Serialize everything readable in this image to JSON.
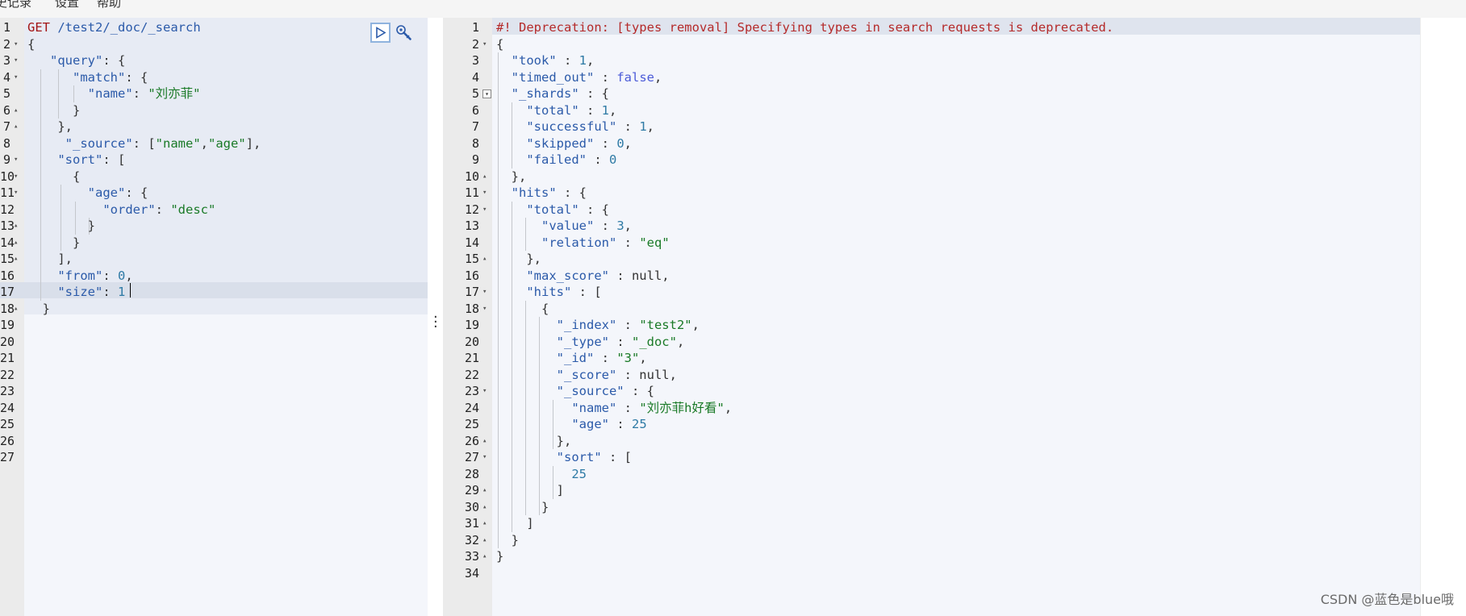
{
  "menu": {
    "items": [
      "史记录",
      "设置",
      "帮助"
    ]
  },
  "request_editor": {
    "lines": [
      {
        "num": "1",
        "fold": "",
        "html": "<span class='m'>GET</span> <span class='k'>/test2/_doc/_search</span>"
      },
      {
        "num": "2",
        "fold": "▾",
        "html": "<span class='p'>{</span>"
      },
      {
        "num": "3",
        "fold": "▾",
        "html": "   <span class='k'>\"query\"</span><span class='p'>: {</span>"
      },
      {
        "num": "4",
        "fold": "▾",
        "html": "      <span class='k'>\"match\"</span><span class='p'>: {</span>"
      },
      {
        "num": "5",
        "fold": "",
        "html": "        <span class='k'>\"name\"</span><span class='p'>: </span><span class='s'>\"刘亦菲\"</span>"
      },
      {
        "num": "6",
        "fold": "▴",
        "html": "      <span class='p'>}</span>"
      },
      {
        "num": "7",
        "fold": "▴",
        "html": "    <span class='p'>},</span>"
      },
      {
        "num": "8",
        "fold": "",
        "html": "     <span class='k'>\"_source\"</span><span class='p'>: [</span><span class='s'>\"name\"</span><span class='p'>,</span><span class='s'>\"age\"</span><span class='p'>],</span>"
      },
      {
        "num": "9",
        "fold": "▾",
        "html": "    <span class='k'>\"sort\"</span><span class='p'>: [</span>"
      },
      {
        "num": "10",
        "fold": "▾",
        "html": "      <span class='p'>{</span>"
      },
      {
        "num": "11",
        "fold": "▾",
        "html": "        <span class='k'>\"age\"</span><span class='p'>: {</span>"
      },
      {
        "num": "12",
        "fold": "",
        "html": "          <span class='k'>\"order\"</span><span class='p'>: </span><span class='s'>\"desc\"</span>"
      },
      {
        "num": "13",
        "fold": "▴",
        "html": "        <span class='p'>}</span>"
      },
      {
        "num": "14",
        "fold": "▴",
        "html": "      <span class='p'>}</span>"
      },
      {
        "num": "15",
        "fold": "▴",
        "html": "    <span class='p'>],</span>"
      },
      {
        "num": "16",
        "fold": "",
        "html": "    <span class='k'>\"from\"</span><span class='p'>: </span><span class='n'>0</span><span class='p'>,</span>"
      },
      {
        "num": "17",
        "fold": "",
        "html": "    <span class='k'>\"size\"</span><span class='p'>: </span><span class='n'>1</span>"
      },
      {
        "num": "18",
        "fold": "▴",
        "html": "  <span class='p'>}</span>"
      },
      {
        "num": "19",
        "fold": "",
        "html": ""
      },
      {
        "num": "20",
        "fold": "",
        "html": ""
      },
      {
        "num": "21",
        "fold": "",
        "html": ""
      },
      {
        "num": "22",
        "fold": "",
        "html": ""
      },
      {
        "num": "23",
        "fold": "",
        "html": ""
      },
      {
        "num": "24",
        "fold": "",
        "html": ""
      },
      {
        "num": "25",
        "fold": "",
        "html": ""
      },
      {
        "num": "26",
        "fold": "",
        "html": ""
      },
      {
        "num": "27",
        "fold": "",
        "html": ""
      }
    ]
  },
  "response_viewer": {
    "lines": [
      {
        "num": "1",
        "fold": "",
        "html": "<span class='warn'>#! Deprecation: [types removal] Specifying types in search requests is deprecated.</span>"
      },
      {
        "num": "2",
        "fold": "▾",
        "html": "<span class='p'>{</span>"
      },
      {
        "num": "3",
        "fold": "",
        "html": "  <span class='k'>\"took\"</span><span class='p'> : </span><span class='n'>1</span><span class='p'>,</span>"
      },
      {
        "num": "4",
        "fold": "",
        "html": "  <span class='k'>\"timed_out\"</span><span class='p'> : </span><span class='b'>false</span><span class='p'>,</span>"
      },
      {
        "num": "5",
        "fold": "box",
        "html": "  <span class='k'>\"_shards\"</span><span class='p'> : {</span>"
      },
      {
        "num": "6",
        "fold": "",
        "html": "    <span class='k'>\"total\"</span><span class='p'> : </span><span class='n'>1</span><span class='p'>,</span>"
      },
      {
        "num": "7",
        "fold": "",
        "html": "    <span class='k'>\"successful\"</span><span class='p'> : </span><span class='n'>1</span><span class='p'>,</span>"
      },
      {
        "num": "8",
        "fold": "",
        "html": "    <span class='k'>\"skipped\"</span><span class='p'> : </span><span class='n'>0</span><span class='p'>,</span>"
      },
      {
        "num": "9",
        "fold": "",
        "html": "    <span class='k'>\"failed\"</span><span class='p'> : </span><span class='n'>0</span>"
      },
      {
        "num": "10",
        "fold": "▴",
        "html": "  <span class='p'>},</span>"
      },
      {
        "num": "11",
        "fold": "▾",
        "html": "  <span class='k'>\"hits\"</span><span class='p'> : {</span>"
      },
      {
        "num": "12",
        "fold": "▾",
        "html": "    <span class='k'>\"total\"</span><span class='p'> : {</span>"
      },
      {
        "num": "13",
        "fold": "",
        "html": "      <span class='k'>\"value\"</span><span class='p'> : </span><span class='n'>3</span><span class='p'>,</span>"
      },
      {
        "num": "14",
        "fold": "",
        "html": "      <span class='k'>\"relation\"</span><span class='p'> : </span><span class='s'>\"eq\"</span>"
      },
      {
        "num": "15",
        "fold": "▴",
        "html": "    <span class='p'>},</span>"
      },
      {
        "num": "16",
        "fold": "",
        "html": "    <span class='k'>\"max_score\"</span><span class='p'> : null,</span>"
      },
      {
        "num": "17",
        "fold": "▾",
        "html": "    <span class='k'>\"hits\"</span><span class='p'> : [</span>"
      },
      {
        "num": "18",
        "fold": "▾",
        "html": "      <span class='p'>{</span>"
      },
      {
        "num": "19",
        "fold": "",
        "html": "        <span class='k'>\"_index\"</span><span class='p'> : </span><span class='s'>\"test2\"</span><span class='p'>,</span>"
      },
      {
        "num": "20",
        "fold": "",
        "html": "        <span class='k'>\"_type\"</span><span class='p'> : </span><span class='s'>\"_doc\"</span><span class='p'>,</span>"
      },
      {
        "num": "21",
        "fold": "",
        "html": "        <span class='k'>\"_id\"</span><span class='p'> : </span><span class='s'>\"3\"</span><span class='p'>,</span>"
      },
      {
        "num": "22",
        "fold": "",
        "html": "        <span class='k'>\"_score\"</span><span class='p'> : null,</span>"
      },
      {
        "num": "23",
        "fold": "▾",
        "html": "        <span class='k'>\"_source\"</span><span class='p'> : {</span>"
      },
      {
        "num": "24",
        "fold": "",
        "html": "          <span class='k'>\"name\"</span><span class='p'> : </span><span class='s'>\"刘亦菲h好看\"</span><span class='p'>,</span>"
      },
      {
        "num": "25",
        "fold": "",
        "html": "          <span class='k'>\"age\"</span><span class='p'> : </span><span class='n'>25</span>"
      },
      {
        "num": "26",
        "fold": "▴",
        "html": "        <span class='p'>},</span>"
      },
      {
        "num": "27",
        "fold": "▾",
        "html": "        <span class='k'>\"sort\"</span><span class='p'> : [</span>"
      },
      {
        "num": "28",
        "fold": "",
        "html": "          <span class='n'>25</span>"
      },
      {
        "num": "29",
        "fold": "▴",
        "html": "        <span class='p'>]</span>"
      },
      {
        "num": "30",
        "fold": "▴",
        "html": "      <span class='p'>}</span>"
      },
      {
        "num": "31",
        "fold": "▴",
        "html": "    <span class='p'>]</span>"
      },
      {
        "num": "32",
        "fold": "▴",
        "html": "  <span class='p'>}</span>"
      },
      {
        "num": "33",
        "fold": "▴",
        "html": "<span class='p'>}</span>"
      },
      {
        "num": "34",
        "fold": "",
        "html": ""
      }
    ]
  },
  "toolbar": {
    "run_icon": "play-icon",
    "wrench_icon": "wrench-icon"
  },
  "watermark": "CSDN @蓝色是blue哦"
}
